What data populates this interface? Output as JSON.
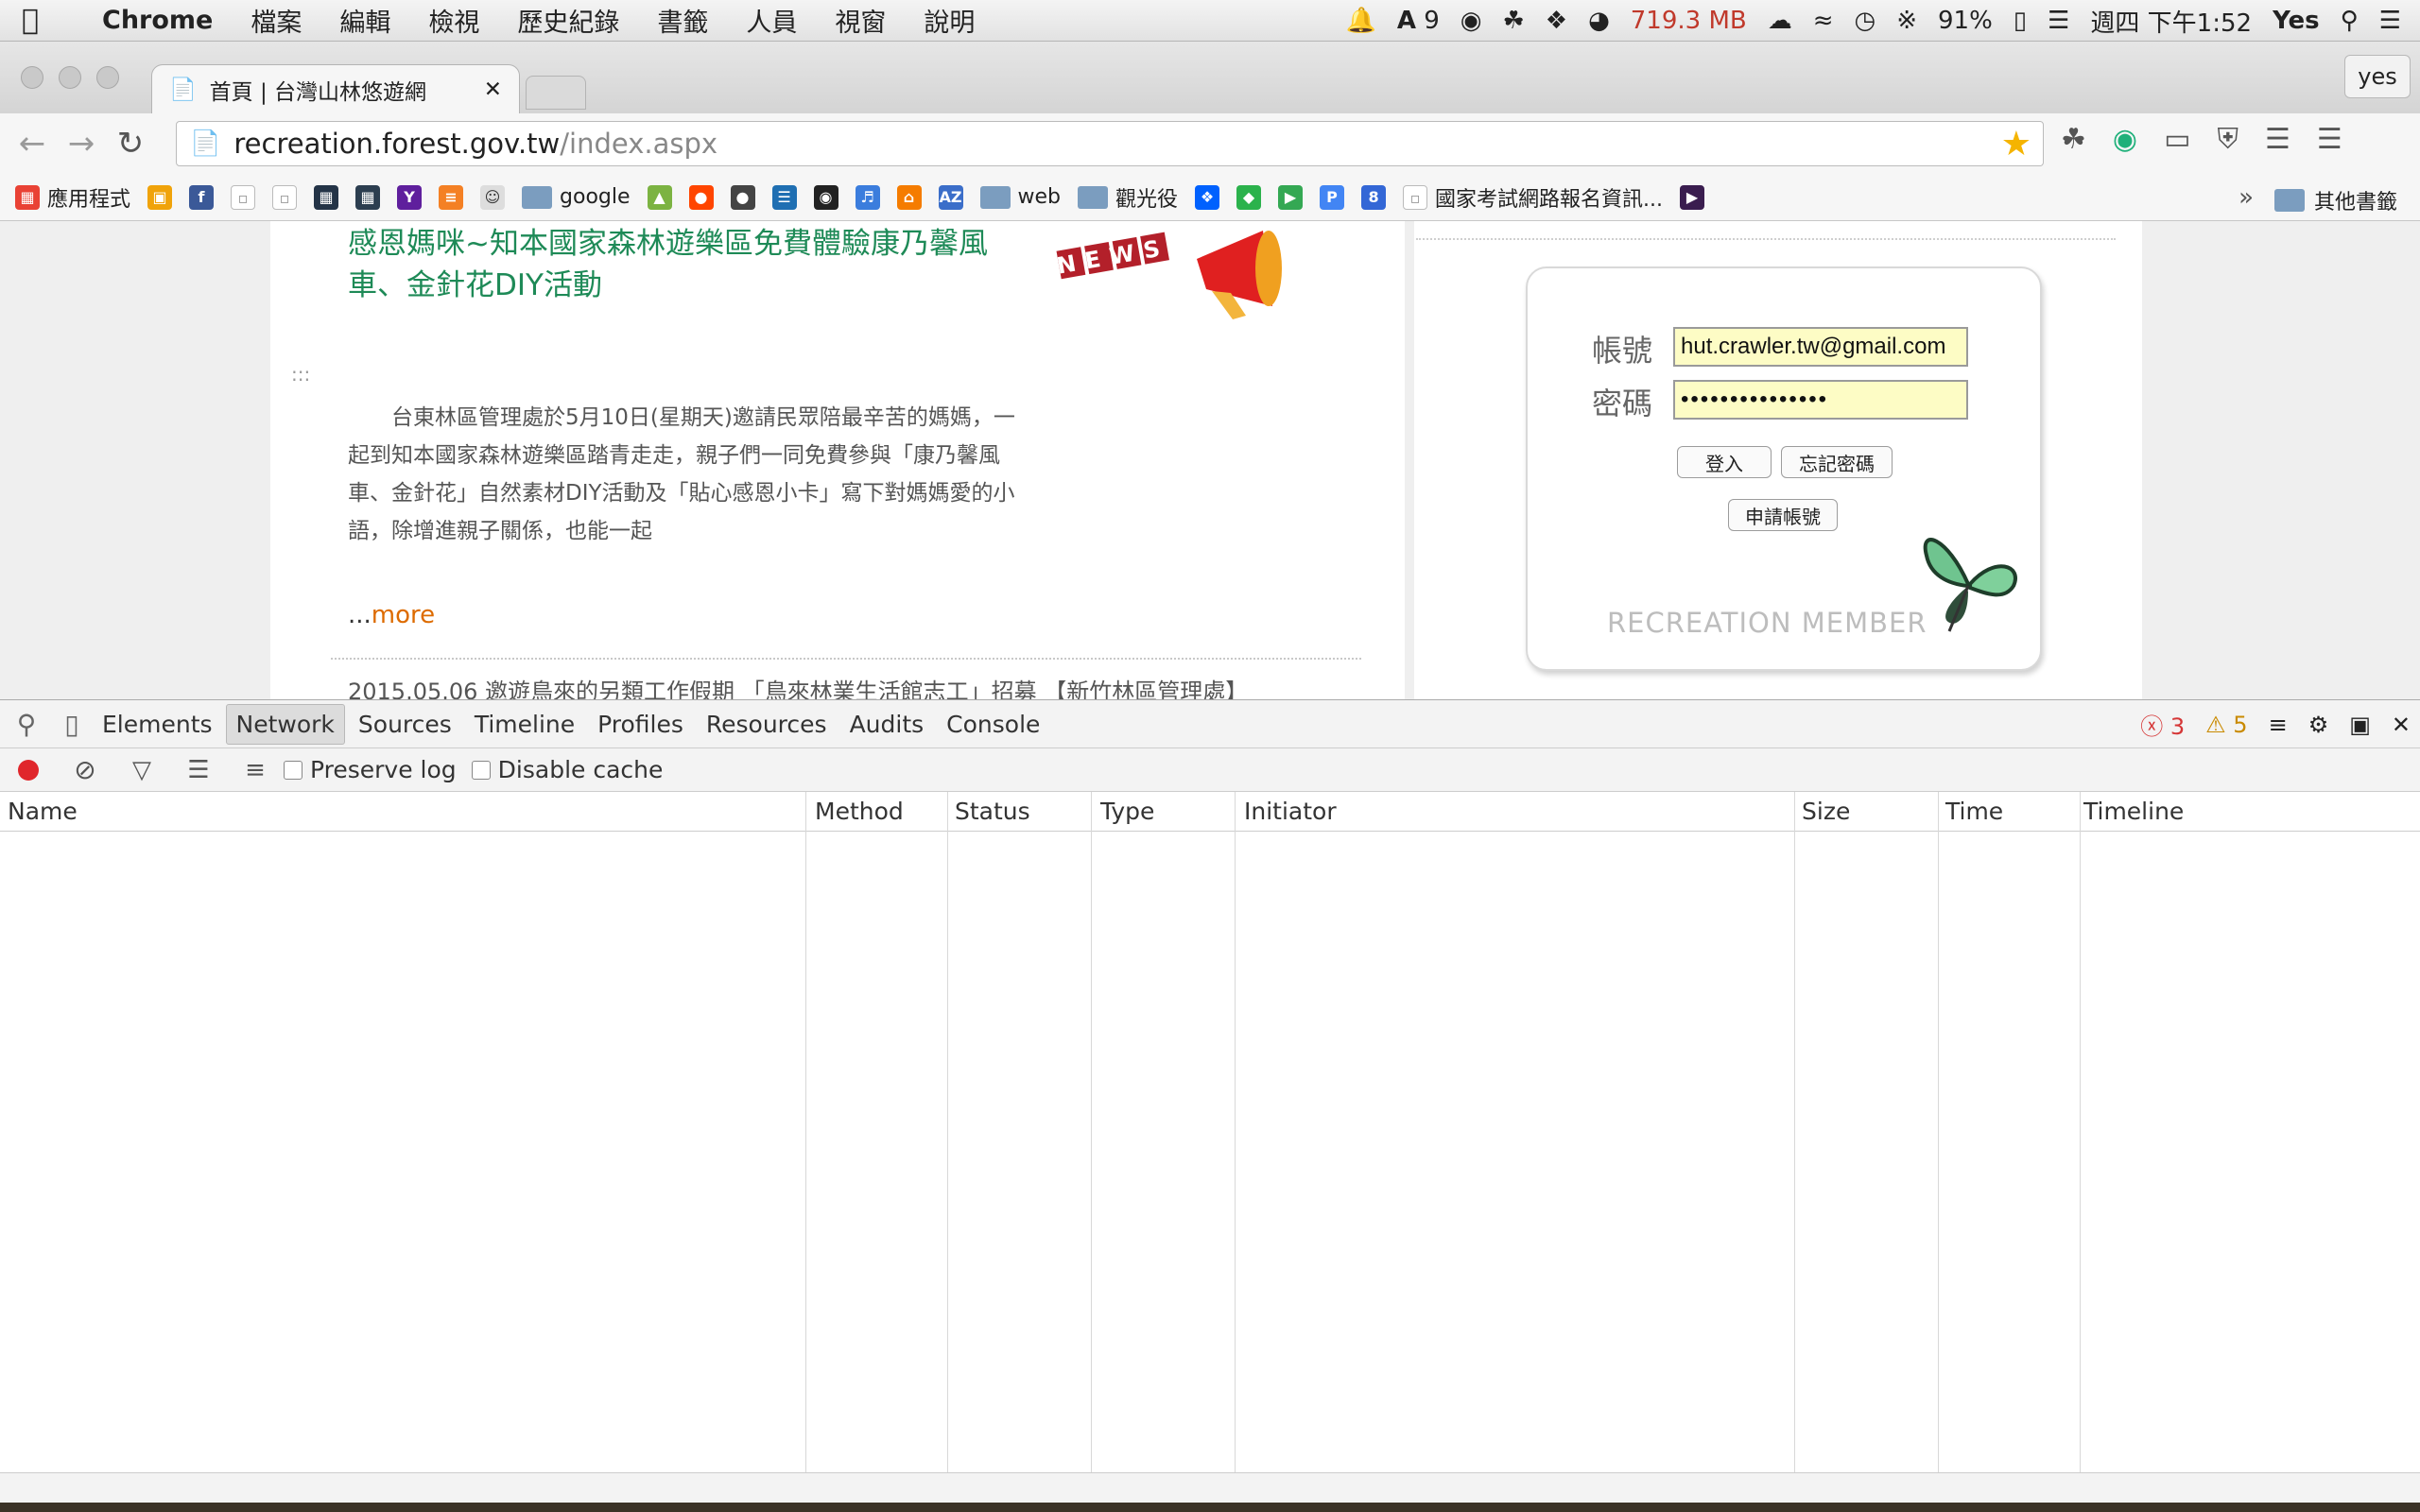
{
  "menubar": {
    "app_name": "Chrome",
    "items": [
      "檔案",
      "編輯",
      "檢視",
      "歷史紀錄",
      "書籤",
      "人員",
      "視窗",
      "說明"
    ],
    "notification_count": "9",
    "memory": "719.3 MB",
    "battery": "91%",
    "clock": "週四 下午1:52",
    "user": "Yes"
  },
  "browser": {
    "tab_title": "首頁 | 台灣山林悠遊網",
    "profile": "yes",
    "url_host": "recreation.forest.gov.tw",
    "url_path": "/index.aspx",
    "bookmarks": {
      "apps": "應用程式",
      "google": "google",
      "web": "web",
      "sightseeing": "觀光役",
      "exam": "國家考試網路報名資訊...",
      "more": "»",
      "other": "其他書籤"
    }
  },
  "page": {
    "news_title": "感恩媽咪~知本國家森林遊樂區免費體驗康乃馨風車、金針花DIY活動",
    "news_badge": "NEWS",
    "grip": ":::",
    "news_body": "台東林區管理處於5月10日(星期天)邀請民眾陪最辛苦的媽媽，一起到知本國家森林遊樂區踏青走走，親子們一同免費參與「康乃馨風車、金針花」自然素材DIY活動及「貼心感恩小卡」寫下對媽媽愛的小語，除增進親子關係，也能一起",
    "more_prefix": "...",
    "more": "more",
    "next_news": "2015.05.06 邀遊鳥來的另類工作假期 「鳥來林業生活館志工」招募 【新竹林區管理處】",
    "login": {
      "account_label": "帳號",
      "account_value": "hut.crawler.tw@gmail.com",
      "password_label": "密碼",
      "password_value": "•••••••••••••••",
      "login_button": "登入",
      "forgot_button": "忘記密碼",
      "register_button": "申請帳號",
      "caption": "RECREATION MEMBER"
    }
  },
  "devtools": {
    "tabs": [
      "Elements",
      "Network",
      "Sources",
      "Timeline",
      "Profiles",
      "Resources",
      "Audits",
      "Console"
    ],
    "active_tab": "Network",
    "errors": "3",
    "warnings": "5",
    "preserve_log": "Preserve log",
    "disable_cache": "Disable cache",
    "columns": [
      "Name",
      "Method",
      "Status",
      "Type",
      "Initiator",
      "Size",
      "Time",
      "Timeline"
    ]
  },
  "colors": {
    "news_title": "#1e8a57",
    "more_link": "#dd6b00",
    "login_input_bg": "#fdfcc5",
    "record": "#e0262b",
    "memory_text": "#c0392b"
  }
}
